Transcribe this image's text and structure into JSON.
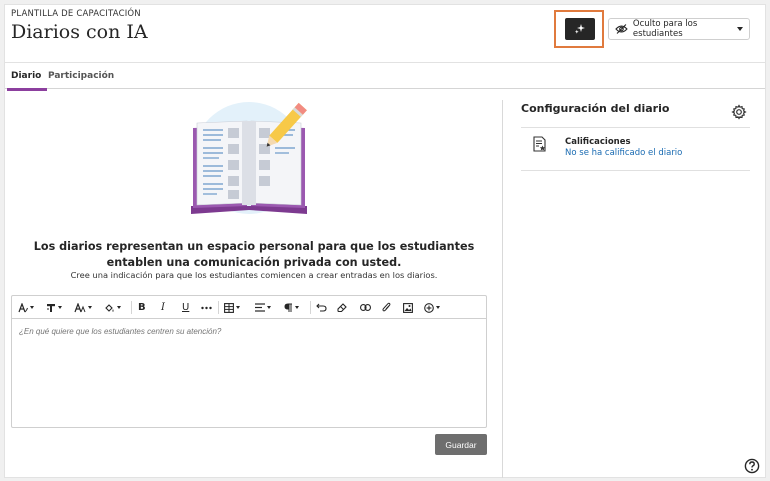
{
  "header": {
    "template_label": "PLANTILLA DE CAPACITACIÓN",
    "title": "Diarios con IA",
    "ai_icon": "sparkle-icon",
    "visibility_icon": "eye-slash-icon",
    "visibility_label": "Oculto para los estudiantes",
    "highlight_color": "#e07a3d"
  },
  "tabs": [
    {
      "label": "Diario",
      "active": true
    },
    {
      "label": "Participación",
      "active": false
    }
  ],
  "main": {
    "illustration": "open-book-pencil-illustration",
    "description": "Los diarios representan un espacio personal para que los estudiantes entablen una comunicación privada con usted.",
    "sub_description": "Cree una indicación para que los estudiantes comiencen a crear entradas en los diarios.",
    "editor": {
      "placeholder": "¿En qué quiere que los estudiantes centren su atención?",
      "toolbar_icons": [
        "text-style-icon",
        "paragraph-format-icon",
        "font-size-icon",
        "text-color-icon",
        "bold-icon",
        "italic-icon",
        "underline-icon",
        "more-icon",
        "table-icon",
        "align-icon",
        "paragraph-icon",
        "undo-icon",
        "clear-format-icon",
        "link-icon",
        "attach-icon",
        "image-icon",
        "insert-icon"
      ],
      "bold": "B",
      "italic": "I",
      "underline": "U"
    },
    "save_label": "Guardar"
  },
  "panel": {
    "title": "Configuración del diario",
    "settings_icon": "gear-icon",
    "grades_icon": "gradebook-icon",
    "grades_title": "Calificaciones",
    "grades_link": "No se ha calificado el diario"
  },
  "colors": {
    "accent_tab": "#8c3f9e",
    "link": "#1a6bb2"
  }
}
